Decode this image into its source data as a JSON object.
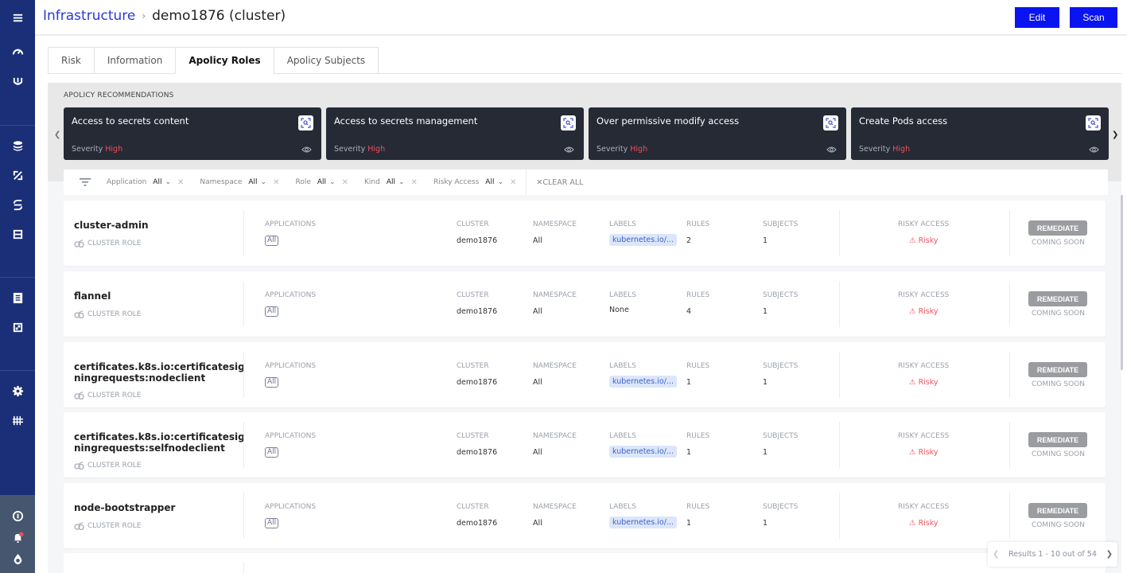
{
  "sidebar": {
    "icons": [
      "menu-icon",
      "dashboard-gauge-icon",
      "shield-icon",
      "layers-icon",
      "policy-icon",
      "link-icon",
      "database-icon",
      "document-icon",
      "report-icon",
      "settings-gear-icon",
      "integrations-icon",
      "info-icon",
      "notifications-bell-icon",
      "drop-icon"
    ],
    "notification_dot_color": "#ef4f5a"
  },
  "header": {
    "breadcrumb_link": "Infrastructure",
    "breadcrumb_sep": "›",
    "breadcrumb_current": "demo1876 (cluster)",
    "edit_label": "Edit",
    "scan_label": "Scan"
  },
  "tabs": [
    {
      "label": "Risk",
      "active": false
    },
    {
      "label": "Information",
      "active": false
    },
    {
      "label": "Apolicy Roles",
      "active": true
    },
    {
      "label": "Apolicy Subjects",
      "active": false
    }
  ],
  "recommendations": {
    "title": "APOLICY RECOMMENDATIONS",
    "severity_label": "Severity",
    "cards": [
      {
        "title": "Access to secrets content",
        "severity": "High"
      },
      {
        "title": "Access to secrets management",
        "severity": "High"
      },
      {
        "title": "Over permissive modify access",
        "severity": "High"
      },
      {
        "title": "Create Pods access",
        "severity": "High"
      }
    ]
  },
  "filters": {
    "items": [
      {
        "label": "Application",
        "value": "All"
      },
      {
        "label": "Namespace",
        "value": "All"
      },
      {
        "label": "Role",
        "value": "All"
      },
      {
        "label": "Kind",
        "value": "All"
      },
      {
        "label": "Risky Access",
        "value": "All"
      }
    ],
    "clear_all": "CLEAR ALL"
  },
  "columns": {
    "applications": "APPLICATIONS",
    "cluster": "CLUSTER",
    "namespace": "NAMESPACE",
    "labels": "LABELS",
    "rules": "RULES",
    "subjects": "SUBJECTS",
    "risky_access": "RISKY ACCESS"
  },
  "roles": [
    {
      "name": "cluster-admin",
      "kind": "CLUSTER ROLE",
      "applications": "All",
      "cluster": "demo1876",
      "namespace": "All",
      "labels": "kubernetes.io/...",
      "rules": "2",
      "subjects": "1",
      "risky": "Risky",
      "remediate": "REMEDIATE",
      "coming_soon": "COMING SOON"
    },
    {
      "name": "flannel",
      "kind": "CLUSTER ROLE",
      "applications": "All",
      "cluster": "demo1876",
      "namespace": "All",
      "labels": "None",
      "rules": "4",
      "subjects": "1",
      "risky": "Risky",
      "remediate": "REMEDIATE",
      "coming_soon": "COMING SOON"
    },
    {
      "name": "certificates.k8s.io:certificatesig ningrequests:nodeclient",
      "kind": "CLUSTER ROLE",
      "applications": "All",
      "cluster": "demo1876",
      "namespace": "All",
      "labels": "kubernetes.io/...",
      "rules": "1",
      "subjects": "1",
      "risky": "Risky",
      "remediate": "REMEDIATE",
      "coming_soon": "COMING SOON"
    },
    {
      "name": "certificates.k8s.io:certificatesig ningrequests:selfnodeclient",
      "kind": "CLUSTER ROLE",
      "applications": "All",
      "cluster": "demo1876",
      "namespace": "All",
      "labels": "kubernetes.io/...",
      "rules": "1",
      "subjects": "1",
      "risky": "Risky",
      "remediate": "REMEDIATE",
      "coming_soon": "COMING SOON"
    },
    {
      "name": "node-bootstrapper",
      "kind": "CLUSTER ROLE",
      "applications": "All",
      "cluster": "demo1876",
      "namespace": "All",
      "labels": "kubernetes.io/...",
      "rules": "1",
      "subjects": "1",
      "risky": "Risky",
      "remediate": "REMEDIATE",
      "coming_soon": "COMING SOON"
    }
  ],
  "pagination": {
    "text": "Results 1 - 10 out of 54"
  }
}
